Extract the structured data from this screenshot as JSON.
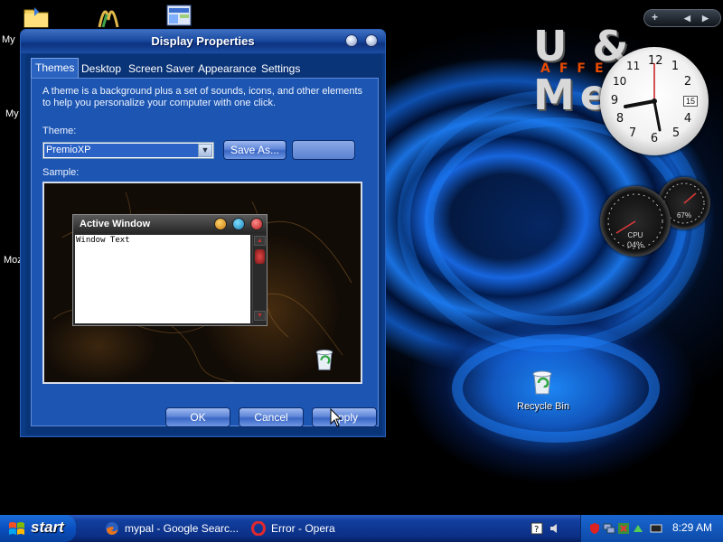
{
  "desktop": {
    "icons": [
      {
        "label": "My",
        "icon": "folder-icon"
      },
      {
        "label": "My",
        "icon": "computer-icon"
      },
      {
        "label": "Moz",
        "icon": "browser-icon"
      }
    ],
    "recycle_bin_label": "Recycle Bin",
    "logo_main": "U & Me",
    "logo_sub": "AFFE",
    "clock_numbers": [
      "12",
      "1",
      "2",
      "3",
      "4",
      "5",
      "6",
      "7",
      "8",
      "9",
      "10",
      "11"
    ],
    "clock_date": "15",
    "gauge_cpu": "CPU",
    "gauge_cpu_value": "04%",
    "gauge_mem_value": "67%"
  },
  "window": {
    "title": "Display Properties",
    "tabs": [
      "Themes",
      "Desktop",
      "Screen Saver",
      "Appearance",
      "Settings"
    ],
    "intro": "A theme is a background plus a set of sounds, icons, and other elements to help you personalize your computer with one click.",
    "theme_label": "Theme:",
    "theme_value": "PremioXP",
    "save_as_label": "Save As...",
    "delete_label": "",
    "sample_label": "Sample:",
    "sample": {
      "window_title": "Active Window",
      "window_text": "Window Text"
    },
    "buttons": {
      "ok": "OK",
      "cancel": "Cancel",
      "apply": "Apply"
    }
  },
  "taskbar": {
    "start": "start",
    "tasks": [
      {
        "label": "mypal - Google Searc...",
        "icon": "firefox-icon"
      },
      {
        "label": "Error - Opera",
        "icon": "opera-icon"
      }
    ],
    "time": "8:29 AM"
  },
  "colors": {
    "taskbar_blue": "#0b2f86",
    "window_blue": "#1d56b2",
    "accent_orange": "#e84a00"
  }
}
